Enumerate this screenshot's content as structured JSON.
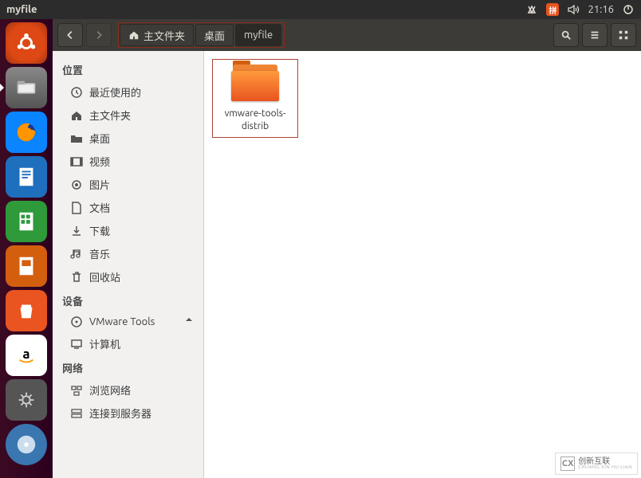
{
  "menubar": {
    "title": "myfile",
    "time": "21:16",
    "ime_label": "拼"
  },
  "launcher": {
    "items": [
      {
        "name": "ubuntu-dash"
      },
      {
        "name": "files",
        "active": true
      },
      {
        "name": "firefox"
      },
      {
        "name": "libreoffice-writer"
      },
      {
        "name": "libreoffice-calc"
      },
      {
        "name": "libreoffice-impress"
      },
      {
        "name": "ubuntu-software"
      },
      {
        "name": "amazon"
      },
      {
        "name": "system-settings"
      },
      {
        "name": "disc"
      }
    ]
  },
  "toolbar": {
    "path": [
      {
        "label": "主文件夹",
        "icon": "home"
      },
      {
        "label": "桌面"
      },
      {
        "label": "myfile",
        "active": true
      }
    ]
  },
  "sidebar": {
    "sections": [
      {
        "title": "位置",
        "items": [
          {
            "icon": "clock",
            "label": "最近使用的"
          },
          {
            "icon": "home",
            "label": "主文件夹"
          },
          {
            "icon": "folder",
            "label": "桌面"
          },
          {
            "icon": "video",
            "label": "视频"
          },
          {
            "icon": "image",
            "label": "图片"
          },
          {
            "icon": "doc",
            "label": "文档"
          },
          {
            "icon": "download",
            "label": "下载"
          },
          {
            "icon": "music",
            "label": "音乐"
          },
          {
            "icon": "trash",
            "label": "回收站"
          }
        ]
      },
      {
        "title": "设备",
        "items": [
          {
            "icon": "disc",
            "label": "VMware Tools",
            "eject": true
          },
          {
            "icon": "computer",
            "label": "计算机"
          }
        ]
      },
      {
        "title": "网络",
        "items": [
          {
            "icon": "network",
            "label": "浏览网络"
          },
          {
            "icon": "server",
            "label": "连接到服务器"
          }
        ]
      }
    ]
  },
  "content": {
    "items": [
      {
        "type": "folder",
        "label": "vmware-tools-distrib"
      }
    ]
  },
  "watermark": {
    "brand": "创新互联",
    "sub": "CHUANG XIN HU LIAN",
    "logo": "CX"
  }
}
